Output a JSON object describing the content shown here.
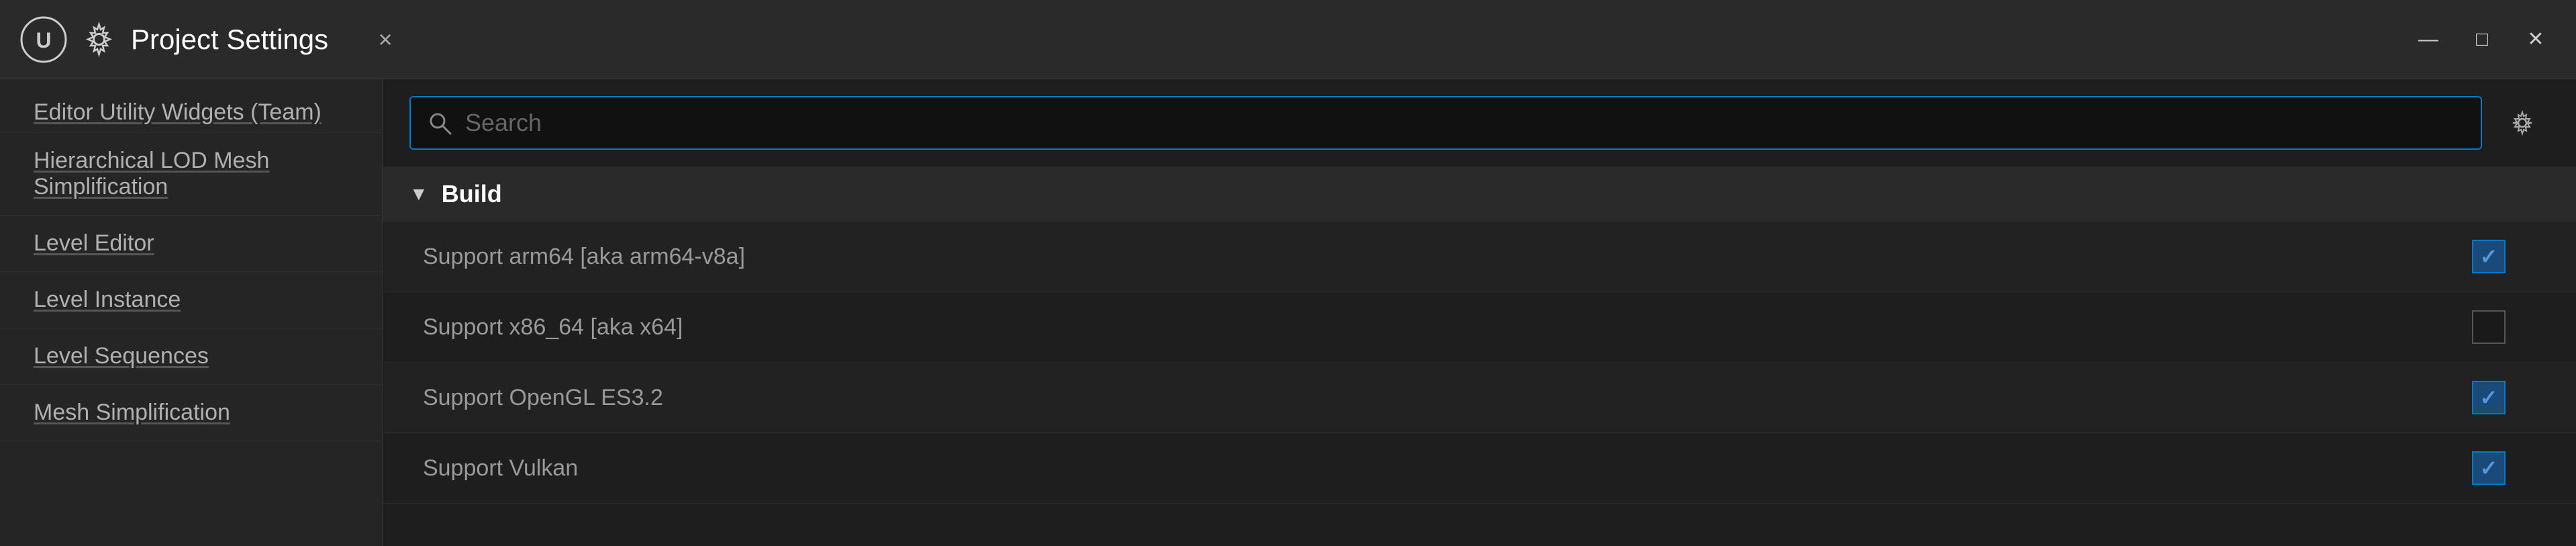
{
  "window": {
    "title": "Project Settings",
    "close_label": "×",
    "minimize_label": "—",
    "maximize_label": "□",
    "close_window_label": "✕"
  },
  "sidebar": {
    "items": [
      {
        "id": "editor-utility-widgets",
        "label": "Editor Utility Widgets (Team)"
      },
      {
        "id": "hierarchical-lod-mesh",
        "label": "Hierarchical LOD Mesh Simplification"
      },
      {
        "id": "level-editor",
        "label": "Level Editor"
      },
      {
        "id": "level-instance",
        "label": "Level Instance"
      },
      {
        "id": "level-sequences",
        "label": "Level Sequences"
      },
      {
        "id": "mesh-simplification",
        "label": "Mesh Simplification"
      }
    ]
  },
  "search": {
    "placeholder": "Search",
    "gear_icon": "⚙"
  },
  "build_section": {
    "title": "Build",
    "settings": [
      {
        "id": "support-arm64",
        "label": "Support arm64 [aka arm64-v8a]",
        "checked": true
      },
      {
        "id": "support-x86-64",
        "label": "Support x86_64 [aka x64]",
        "checked": false
      },
      {
        "id": "support-opengl-es32",
        "label": "Support OpenGL ES3.2",
        "checked": true
      },
      {
        "id": "support-vulkan",
        "label": "Support Vulkan",
        "checked": true
      }
    ]
  }
}
